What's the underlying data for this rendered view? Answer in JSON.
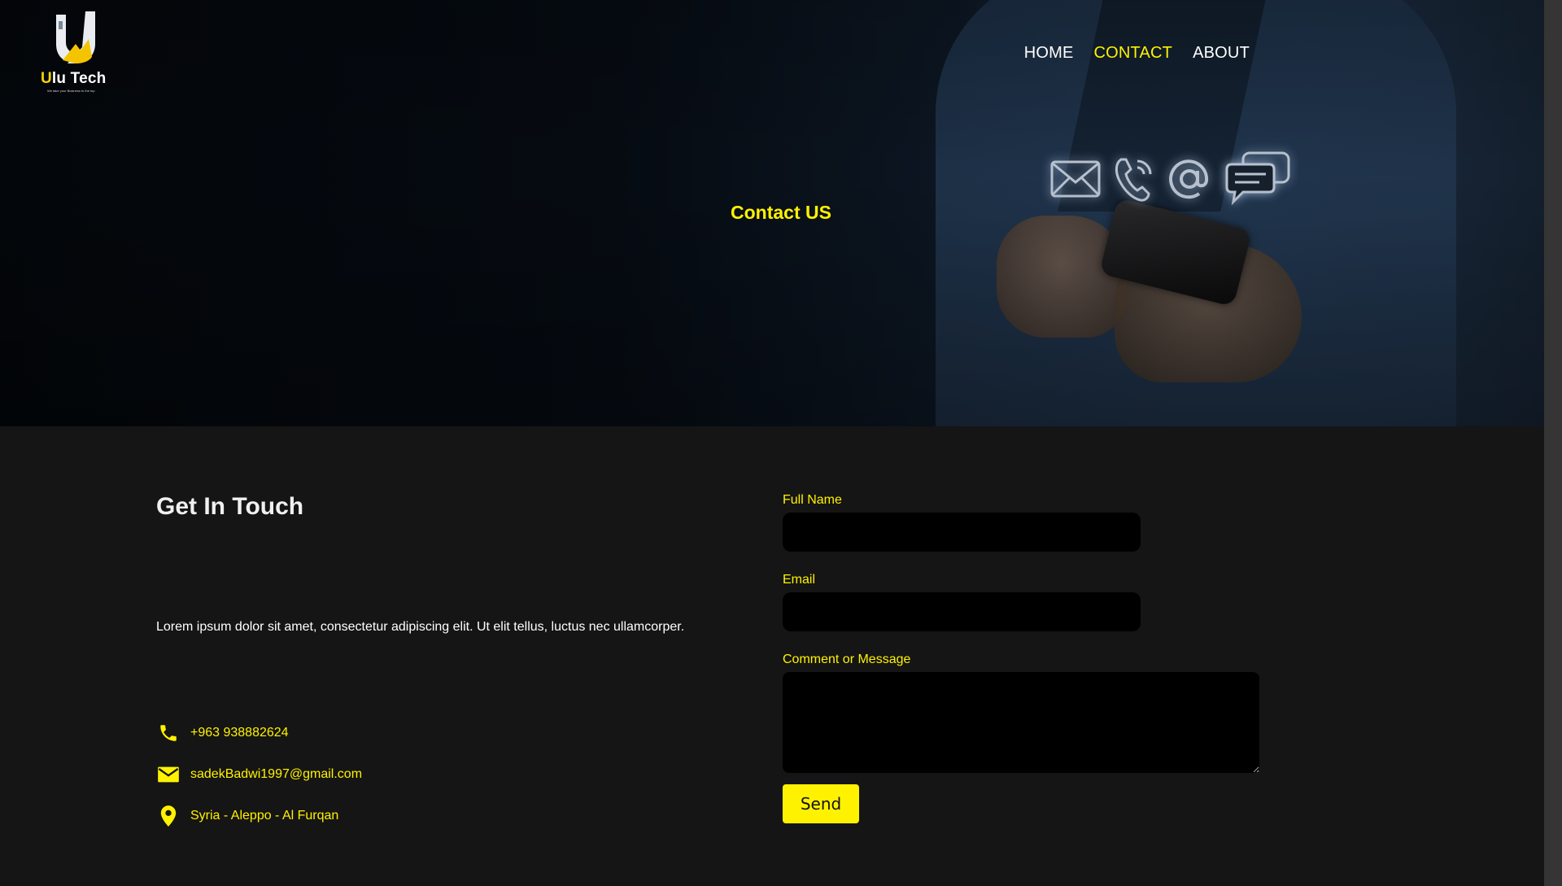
{
  "brand": {
    "name_accent": "U",
    "name_rest": "lu Tech",
    "tagline": "We take your Business to the top"
  },
  "nav": {
    "items": [
      {
        "label": "HOME",
        "active": false
      },
      {
        "label": "CONTACT",
        "active": true
      },
      {
        "label": "ABOUT",
        "active": false
      }
    ]
  },
  "hero": {
    "title": "Contact US",
    "icons": [
      "envelope-icon",
      "phone-icon",
      "at-sign-icon",
      "chat-bubbles-icon"
    ]
  },
  "get_in_touch": {
    "heading": "Get In Touch",
    "description": "Lorem ipsum dolor sit amet, consectetur adipiscing elit. Ut elit tellus, luctus nec ullamcorper.",
    "contacts": [
      {
        "icon": "phone-icon",
        "text": "+963 938882624"
      },
      {
        "icon": "email-icon",
        "text": "sadekBadwi1997@gmail.com"
      },
      {
        "icon": "location-pin-icon",
        "text": "Syria - Aleppo - Al Furqan"
      }
    ]
  },
  "form": {
    "full_name_label": "Full Name",
    "full_name_value": "",
    "email_label": "Email",
    "email_value": "",
    "message_label": "Comment or Message",
    "message_value": "",
    "send_label": "Send"
  },
  "colors": {
    "accent": "#fff200",
    "background": "#151515",
    "input_bg": "#000000"
  }
}
